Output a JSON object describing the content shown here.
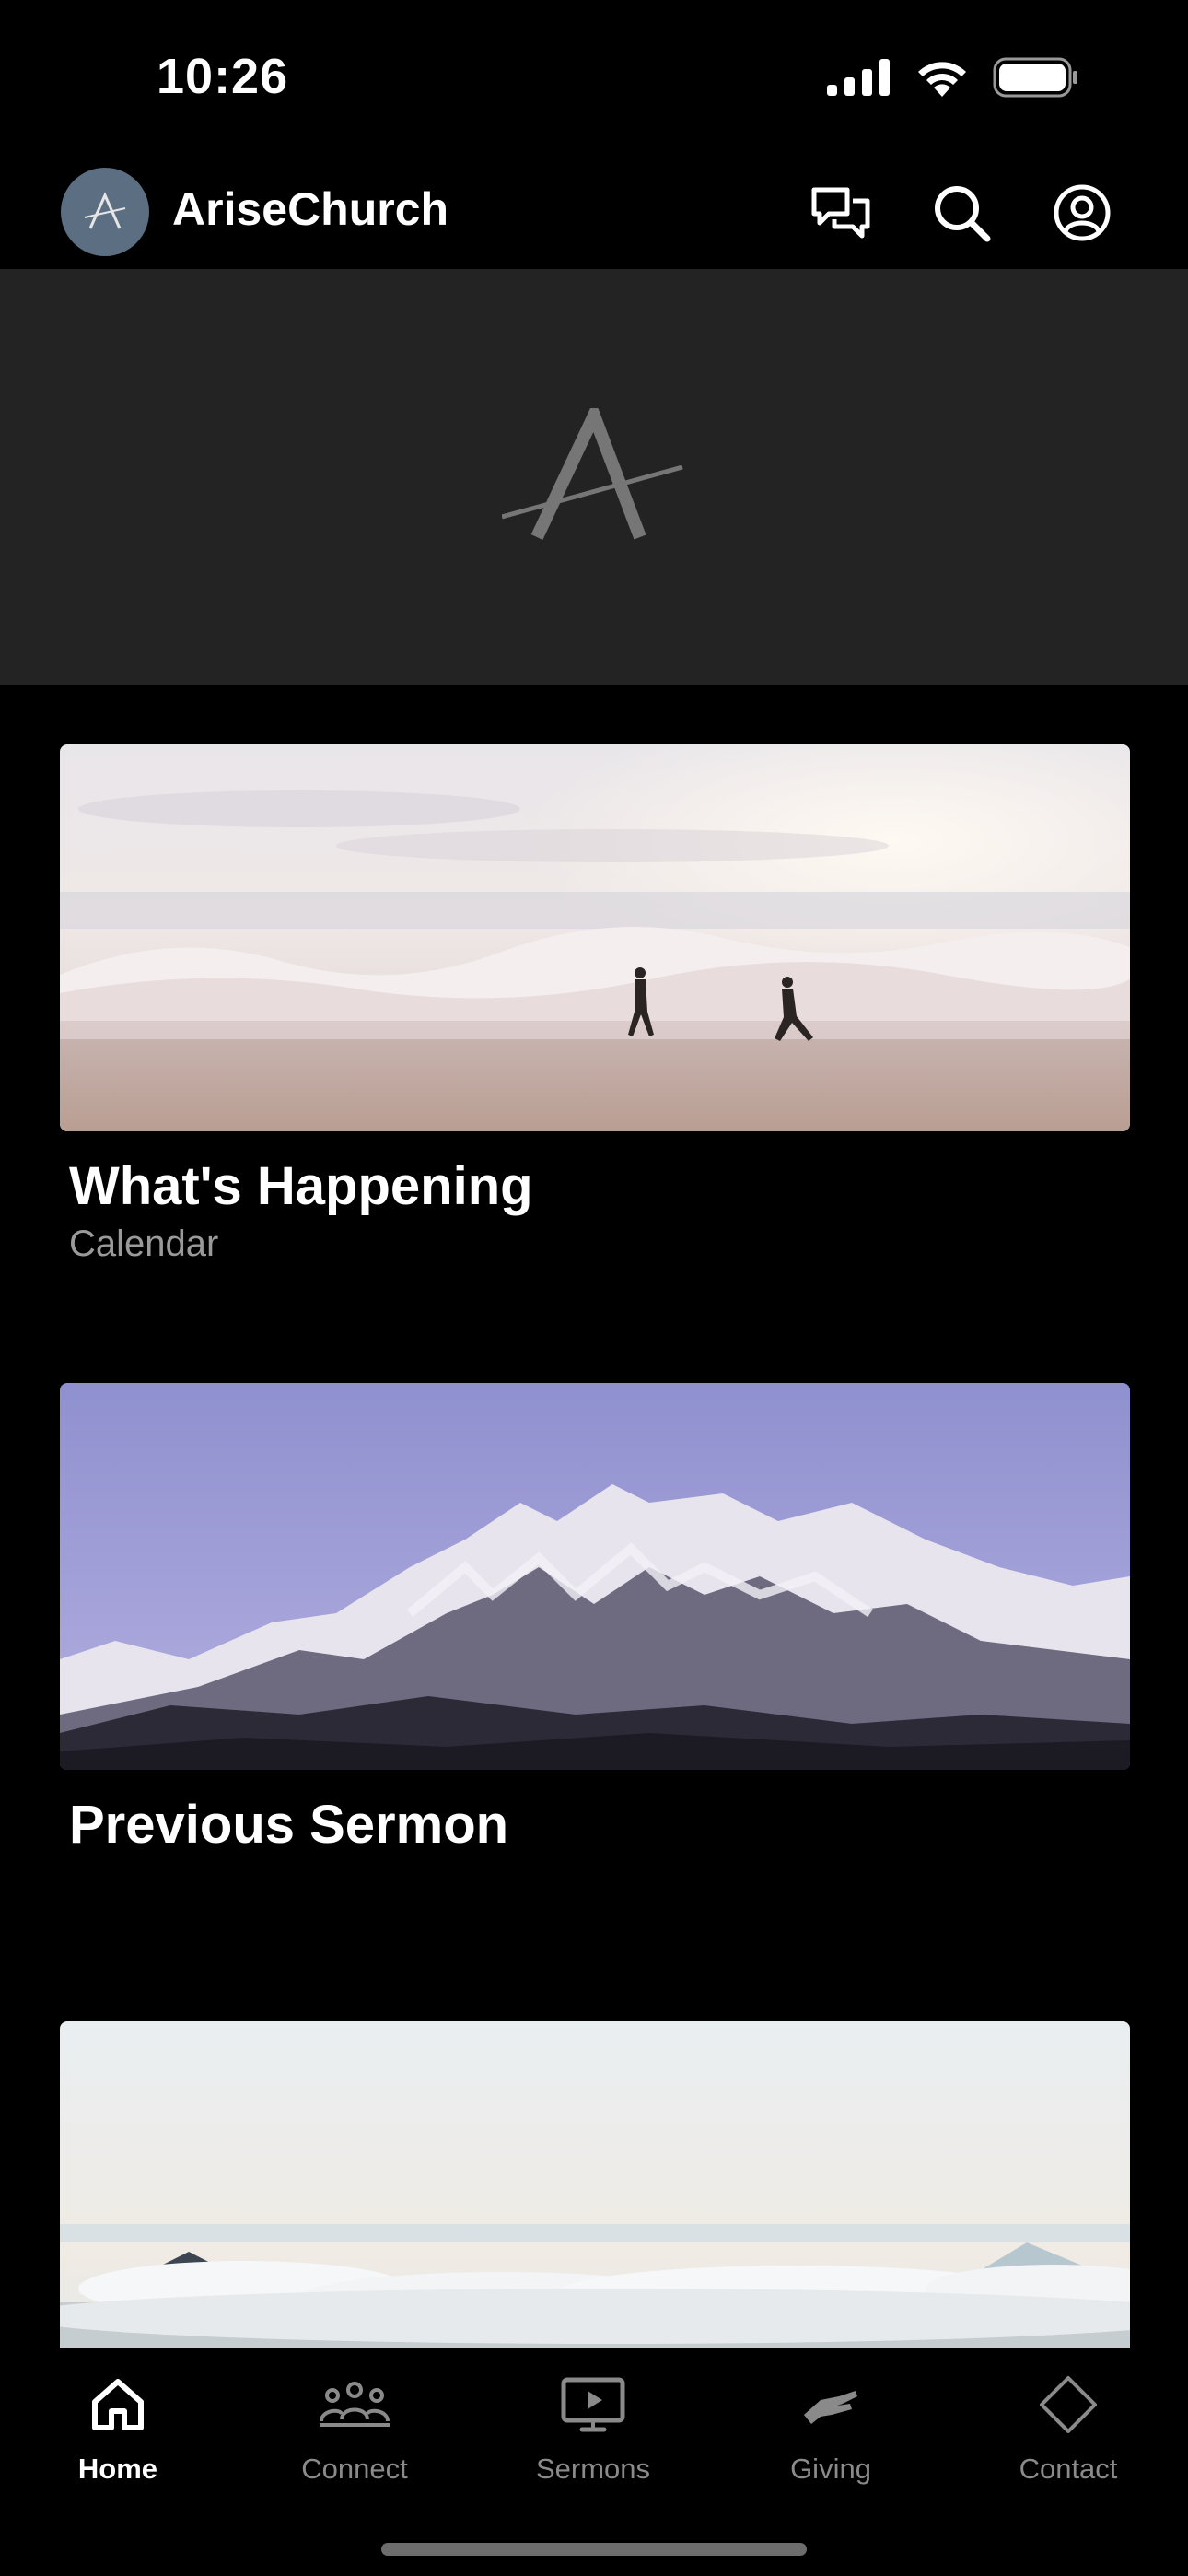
{
  "status_bar": {
    "time": "10:26"
  },
  "header": {
    "title": "AriseChurch",
    "avatar_letter": "A",
    "icons": [
      "chat-icon",
      "search-icon",
      "profile-icon"
    ]
  },
  "hero": {
    "logo_letter": "A"
  },
  "cards": [
    {
      "title": "What's Happening",
      "subtitle": "Calendar",
      "image": "ocean-waves-runners"
    },
    {
      "title": "Previous Sermon",
      "subtitle": "",
      "image": "snowy-mountain"
    },
    {
      "title": "",
      "subtitle": "",
      "image": "clouds-mountain-peaks"
    }
  ],
  "tabs": [
    {
      "label": "Home",
      "icon": "home-icon",
      "active": true
    },
    {
      "label": "Connect",
      "icon": "people-icon",
      "active": false
    },
    {
      "label": "Sermons",
      "icon": "tv-play-icon",
      "active": false
    },
    {
      "label": "Giving",
      "icon": "hand-icon",
      "active": false
    },
    {
      "label": "Contact",
      "icon": "diamond-icon",
      "active": false
    }
  ],
  "colors": {
    "background": "#000000",
    "hero_background": "#232323",
    "avatar": "#5c6e82",
    "tab_inactive": "#8a8a8a",
    "tab_active": "#ffffff",
    "subtitle": "#9a9a9a"
  }
}
